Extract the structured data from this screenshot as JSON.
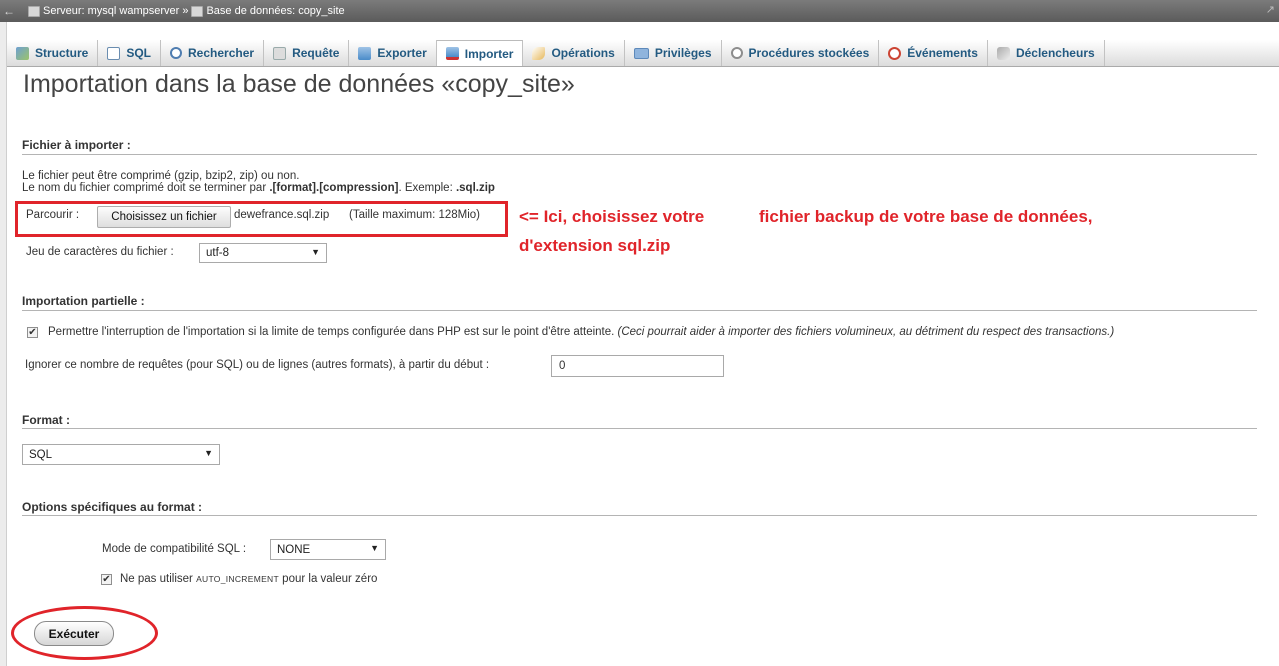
{
  "topbar": {
    "server": "Serveur: mysql wampserver",
    "separator": "»",
    "database": "Base de données: copy_site"
  },
  "tabs": [
    {
      "label": "Structure",
      "icon": "structure-icon"
    },
    {
      "label": "SQL",
      "icon": "sql-icon"
    },
    {
      "label": "Rechercher",
      "icon": "search-icon"
    },
    {
      "label": "Requête",
      "icon": "query-icon"
    },
    {
      "label": "Exporter",
      "icon": "export-icon"
    },
    {
      "label": "Importer",
      "icon": "import-icon",
      "active": true
    },
    {
      "label": "Opérations",
      "icon": "wrench-icon"
    },
    {
      "label": "Privilèges",
      "icon": "privileges-icon"
    },
    {
      "label": "Procédures stockées",
      "icon": "procedures-icon"
    },
    {
      "label": "Événements",
      "icon": "clock-icon"
    },
    {
      "label": "Déclencheurs",
      "icon": "triggers-icon"
    }
  ],
  "page": {
    "title": "Importation dans la base de données «copy_site»"
  },
  "file_section": {
    "heading": "Fichier à importer :",
    "hint1": "Le fichier peut être comprimé (gzip, bzip2, zip) ou non.",
    "hint2_prefix": "Le nom du fichier comprimé doit se terminer par ",
    "hint2_format": ".[format].[compression]",
    "hint2_mid": ". Exemple: ",
    "hint2_example": ".sql.zip",
    "browse_label": "Parcourir :",
    "choose_button": "Choisissez un fichier",
    "file_name": "dewefrance.sql.zip",
    "max_size": "(Taille maximum: 128Mio)",
    "charset_label": "Jeu de caractères du fichier :",
    "charset_value": "utf-8"
  },
  "annotation": {
    "line1a": "<= Ici, choisissez votre",
    "line1b": "fichier backup de votre base de données,",
    "line2": "d'extension sql.zip"
  },
  "partial_section": {
    "heading": "Importation partielle :",
    "allow_interrupt_label": "Permettre l'interruption de l'importation si la limite de temps configurée dans PHP est sur le point d'être atteinte.",
    "allow_interrupt_note": "(Ceci pourrait aider à importer des fichiers volumineux, au détriment du respect des transactions.)",
    "allow_interrupt_checked": true,
    "skip_label": "Ignorer ce nombre de requêtes (pour SQL) ou de lignes (autres formats), à partir du début :",
    "skip_value": "0"
  },
  "format_section": {
    "heading": "Format :",
    "format_value": "SQL"
  },
  "options_section": {
    "heading": "Options spécifiques au format :",
    "compat_label": "Mode de compatibilité SQL :",
    "compat_value": "NONE",
    "no_auto_prefix": "Ne pas utiliser ",
    "no_auto_code": "AUTO_INCREMENT",
    "no_auto_suffix": " pour la valeur zéro",
    "no_auto_checked": true
  },
  "actions": {
    "execute_button": "Exécuter"
  },
  "colors": {
    "annotation_red": "#e0242a",
    "tab_text": "#235a81"
  }
}
